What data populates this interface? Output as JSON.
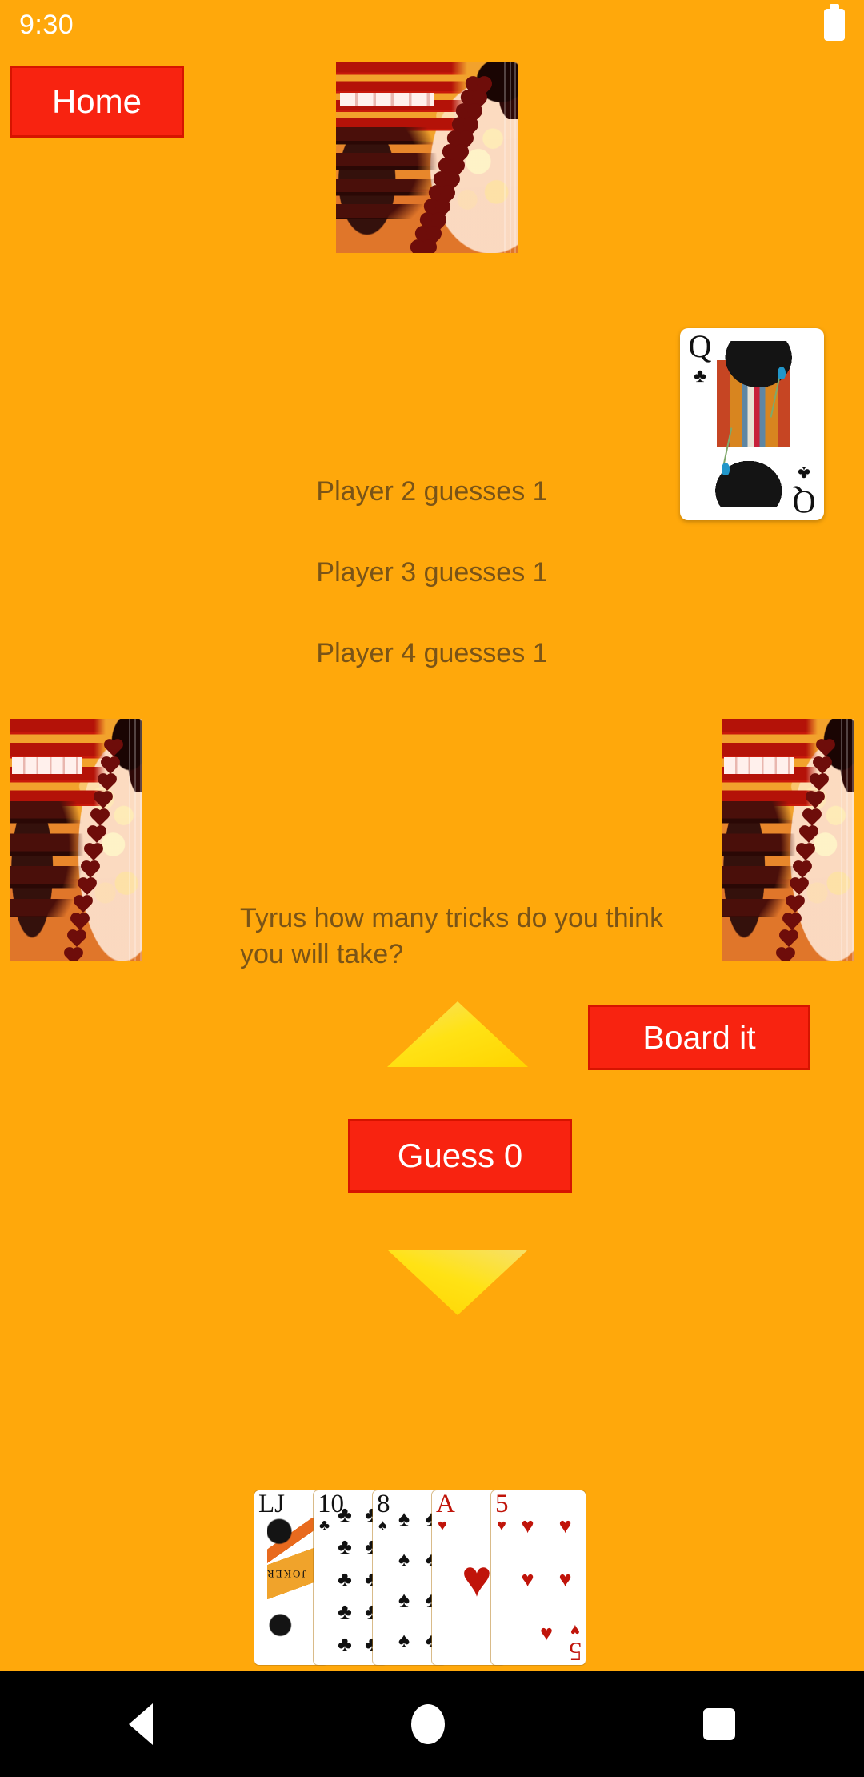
{
  "status_bar": {
    "time": "9:30",
    "battery_icon": "battery-full-icon"
  },
  "background_color": "#FFA80B",
  "accent_color": "#F82310",
  "text_color": "#7A5417",
  "buttons": {
    "home_label": "Home",
    "board_it_label": "Board it",
    "guess_label": "Guess 0"
  },
  "controls": {
    "increase_icon": "triangle-up-icon",
    "decrease_icon": "triangle-down-icon",
    "triangle_color": "#FFE215"
  },
  "guesses": [
    "Player 2 guesses 1",
    "Player 3 guesses 1",
    "Player 4 guesses 1"
  ],
  "prompt": "Tyrus how many tricks do you think you will take?",
  "played_card": {
    "rank": "Q",
    "suit_symbol": "♣",
    "name": "queen-of-clubs",
    "color": "#111111"
  },
  "opponent_stacks": [
    {
      "name": "top-card-stack",
      "position": "top"
    },
    {
      "name": "left-card-stack",
      "position": "left"
    },
    {
      "name": "right-card-stack",
      "position": "right"
    }
  ],
  "player_hand": [
    {
      "rank": "LJ",
      "suit": "joker",
      "suit_symbol": "",
      "color": "black",
      "pips": 0
    },
    {
      "rank": "10",
      "suit": "clubs",
      "suit_symbol": "♣",
      "color": "black",
      "pips": 10
    },
    {
      "rank": "8",
      "suit": "spades",
      "suit_symbol": "♠",
      "color": "black",
      "pips": 8
    },
    {
      "rank": "A",
      "suit": "hearts",
      "suit_symbol": "♥",
      "color": "red",
      "pips": 1
    },
    {
      "rank": "5",
      "suit": "hearts",
      "suit_symbol": "♥",
      "color": "red",
      "pips": 5
    }
  ],
  "joker_word": "JOKER",
  "nav_bar": {
    "back_icon": "back-triangle-icon",
    "home_icon": "home-circle-icon",
    "recents_icon": "recents-square-icon"
  }
}
